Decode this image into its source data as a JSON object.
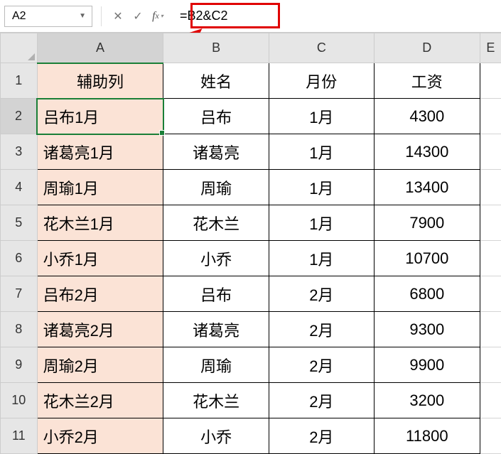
{
  "formula_bar": {
    "name_box": "A2",
    "formula": "=B2&C2"
  },
  "columns": [
    "A",
    "B",
    "C",
    "D",
    "E"
  ],
  "active_column": "A",
  "active_row": 2,
  "headers": {
    "A": "辅助列",
    "B": "姓名",
    "C": "月份",
    "D": "工资"
  },
  "chart_data": {
    "type": "table",
    "columns": [
      "辅助列",
      "姓名",
      "月份",
      "工资"
    ],
    "rows": [
      [
        "吕布1月",
        "吕布",
        "1月",
        4300
      ],
      [
        "诸葛亮1月",
        "诸葛亮",
        "1月",
        14300
      ],
      [
        "周瑜1月",
        "周瑜",
        "1月",
        13400
      ],
      [
        "花木兰1月",
        "花木兰",
        "1月",
        7900
      ],
      [
        "小乔1月",
        "小乔",
        "1月",
        10700
      ],
      [
        "吕布2月",
        "吕布",
        "2月",
        6800
      ],
      [
        "诸葛亮2月",
        "诸葛亮",
        "2月",
        9300
      ],
      [
        "周瑜2月",
        "周瑜",
        "2月",
        9900
      ],
      [
        "花木兰2月",
        "花木兰",
        "2月",
        3200
      ],
      [
        "小乔2月",
        "小乔",
        "2月",
        11800
      ]
    ]
  }
}
